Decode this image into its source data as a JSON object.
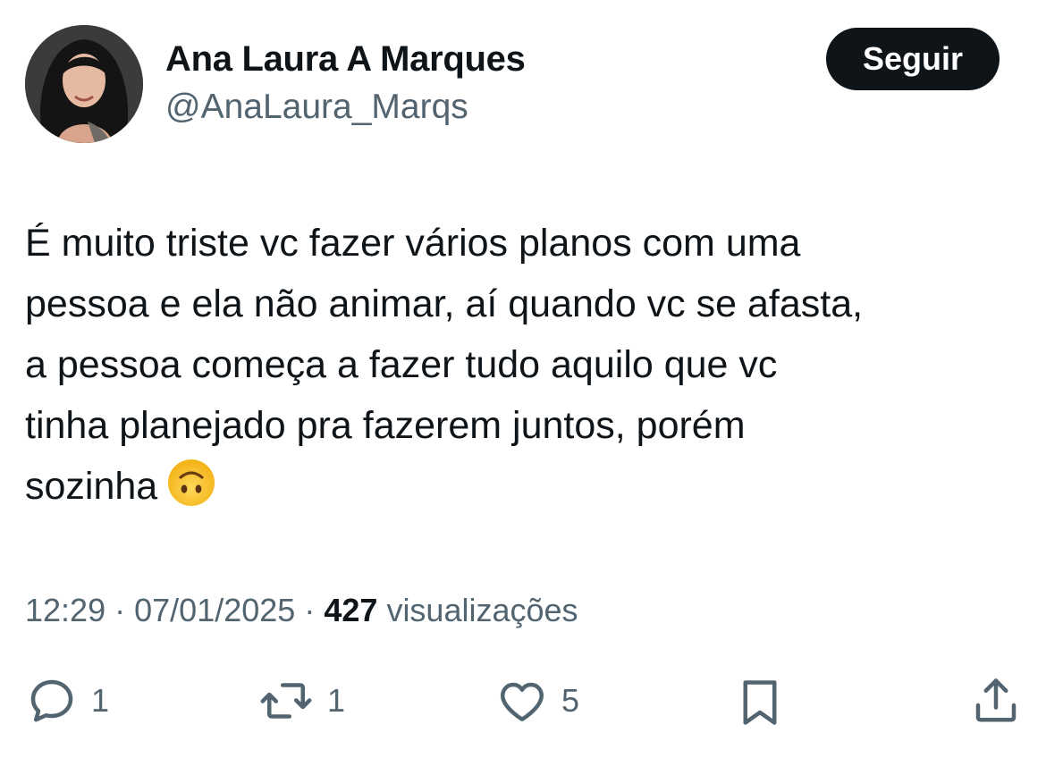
{
  "author": {
    "display_name": "Ana Laura A Marques",
    "handle": "@AnaLaura_Marqs"
  },
  "follow_button": {
    "label": "Seguir"
  },
  "tweet": {
    "lines": [
      "É muito triste vc fazer vários planos com uma",
      "pessoa e ela não animar, aí quando vc se afasta,",
      "a pessoa começa a fazer tudo aquilo que vc",
      "tinha planejado pra fazerem juntos, porém",
      "sozinha"
    ],
    "emoji": "upside-down-face-emoji"
  },
  "meta": {
    "time": "12:29",
    "separator": "·",
    "date": "07/01/2025",
    "views_count": "427",
    "views_label": "visualizações"
  },
  "actions": {
    "reply": {
      "icon": "reply-icon",
      "count": "1"
    },
    "retweet": {
      "icon": "retweet-icon",
      "count": "1"
    },
    "like": {
      "icon": "heart-icon",
      "count": "5"
    },
    "bookmark": {
      "icon": "bookmark-icon"
    },
    "share": {
      "icon": "share-icon"
    }
  },
  "colors": {
    "text": "#0f1419",
    "secondary_text": "#536471",
    "button_bg": "#0f1419",
    "button_text": "#ffffff",
    "background": "#ffffff"
  }
}
